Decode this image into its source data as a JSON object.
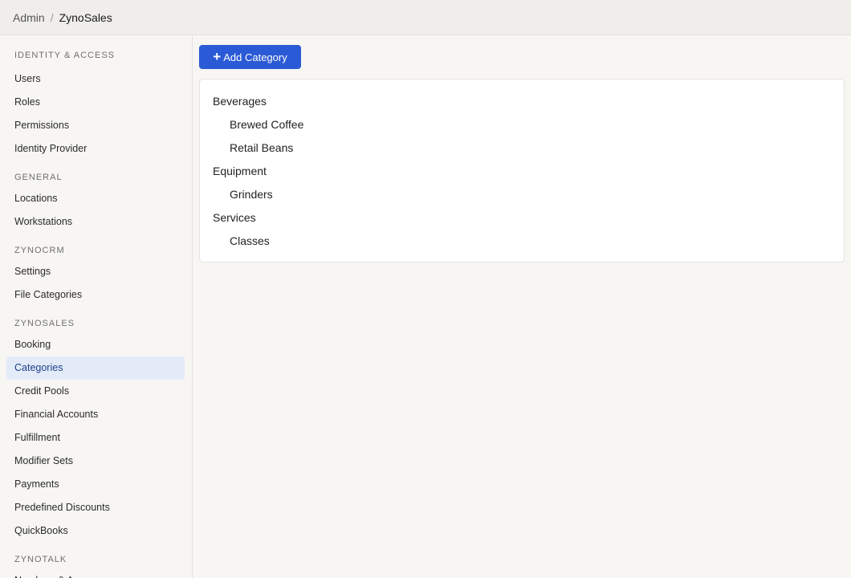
{
  "breadcrumb": {
    "root": "Admin",
    "separator": "/",
    "current": "ZynoSales"
  },
  "sidebar": {
    "sections": [
      {
        "title": "IDENTITY & ACCESS",
        "items": [
          "Users",
          "Roles",
          "Permissions",
          "Identity Provider"
        ]
      },
      {
        "title": "GENERAL",
        "items": [
          "Locations",
          "Workstations"
        ]
      },
      {
        "title": "ZYNOCRM",
        "items": [
          "Settings",
          "File Categories"
        ]
      },
      {
        "title": "ZYNOSALES",
        "items": [
          "Booking",
          "Categories",
          "Credit Pools",
          "Financial Accounts",
          "Fulfillment",
          "Modifier Sets",
          "Payments",
          "Predefined Discounts",
          "QuickBooks"
        ]
      },
      {
        "title": "ZYNOTALK",
        "items": [
          "Numbers & A..."
        ]
      }
    ],
    "active_item": "Categories"
  },
  "main": {
    "add_button": {
      "icon": "plus-icon",
      "label": "Add Category"
    },
    "categories": [
      {
        "label": "Beverages",
        "children": [
          "Brewed Coffee",
          "Retail Beans"
        ]
      },
      {
        "label": "Equipment",
        "children": [
          "Grinders"
        ]
      },
      {
        "label": "Services",
        "children": [
          "Classes"
        ]
      }
    ]
  },
  "colors": {
    "accent": "#2b5ad6",
    "active_bg": "#e3ebf9",
    "active_text": "#1f3f86"
  }
}
